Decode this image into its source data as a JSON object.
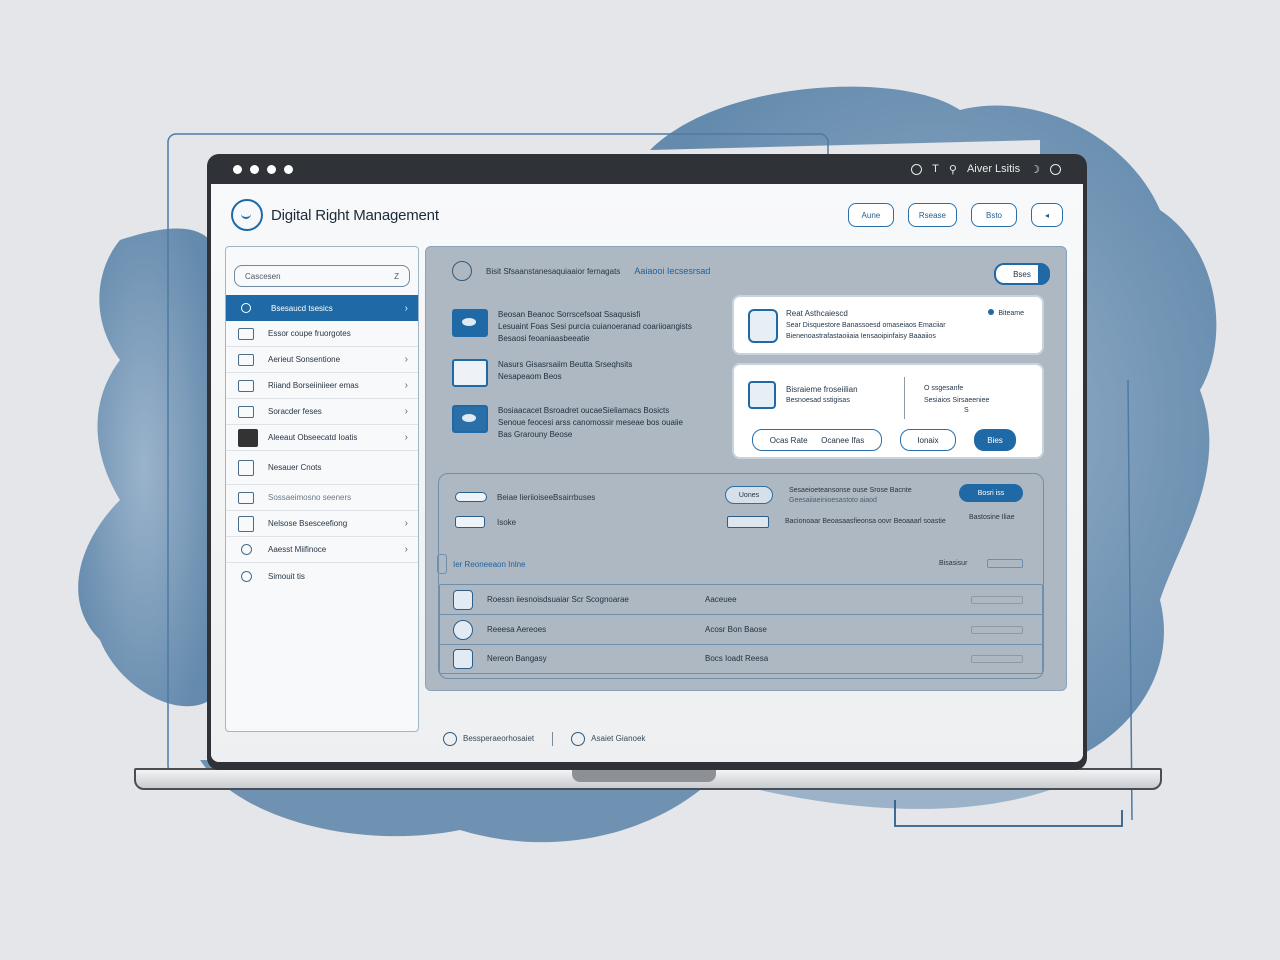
{
  "window": {
    "tray_text": "Aiver Lsitis"
  },
  "header": {
    "title": "Digital Right Management",
    "buttons": [
      "Aune",
      "Rsease",
      "Bsto",
      "◂"
    ]
  },
  "sidebar": {
    "search_placeholder": "Cascesen",
    "search_key": "Z",
    "items": [
      {
        "label": "Bsesaucd tsesics",
        "icon": "circle-icon",
        "active": true,
        "chevron": true
      },
      {
        "label": "Essor coupe fruorgotes",
        "icon": "image-icon",
        "active": false,
        "chevron": false
      },
      {
        "label": "Aerieut Sonsentione",
        "icon": "monitor-icon",
        "active": false,
        "chevron": true
      },
      {
        "label": "Riiand Borseiiniieer emas",
        "icon": "card-icon",
        "active": false,
        "chevron": true
      },
      {
        "label": "Soracder feses",
        "icon": "export-icon",
        "active": false,
        "chevron": true
      },
      {
        "label": "Aleeaut Obseecatd Ioatis",
        "icon": "document-dark-icon",
        "active": false,
        "chevron": true
      },
      {
        "label": "Nesauer Cnots",
        "icon": "file-icon",
        "active": false,
        "chevron": false
      },
      {
        "label": "Sossaeimosno seeners",
        "icon": "window-icon",
        "active": false,
        "chevron": false
      },
      {
        "label": "Nelsose Bsesceefiong",
        "icon": "frame-icon",
        "active": false,
        "chevron": true
      },
      {
        "label": "Aaesst Miifinoce",
        "icon": "ring-icon",
        "active": false,
        "chevron": true
      },
      {
        "label": "Simouit tis",
        "icon": "ring-icon",
        "active": false,
        "chevron": false
      }
    ]
  },
  "main": {
    "head_label": "Bisit Sfsaanstanesaquiaaior fernagats",
    "head_accent": "Aaiaooi Iecsesrsad",
    "toggle_label": "Bses",
    "features": [
      {
        "line1": "Beosan Beanoc Sorrscefsoat Ssaqusisfi",
        "line2": "Lesuaint Foas Sesi purcia cuianoeranad coariioangists",
        "line3": "Besaosi feoaniaasbeeatie"
      },
      {
        "line1": "Nasurs Gisasrsaiim Beutta Srseqhsits",
        "line2": "Nesapeaom Beos",
        "line3": ""
      },
      {
        "line1": "Bosiaacacet Bsroadret oucaeSieliamacs Bosicts",
        "line2": "Senoue feocesi arss canomossir meseae bos ouaiie",
        "line3": "Bas Grarouny Beose"
      }
    ],
    "card1": {
      "title": "Reat Asthcaiescd",
      "line1": "Sear Disquestore Banassoesd omaseiaos Emaciiar",
      "line2": "Bienenoastrafastaoiiaia Iensaoipinfaisy Baaaiios",
      "status": "Biteame"
    },
    "card2": {
      "title": "Bisraieme froseiilian",
      "subtitle": "Besnoesad sstigisas",
      "right1": "O ssgesanfe",
      "right2": "Sesiaios Sirsaeeniee",
      "right3": "S",
      "btn1": "Ocas Rate",
      "btn2": "Ocanee Ifas",
      "btn3": "Ionaix",
      "btn4": "Bies"
    },
    "sub": {
      "row1_label": "Beiae lieriioiseeBsairrbuses",
      "row1_btn": "Uones",
      "row1_right": "Sesaeioeteansonse ouse Srose Bacnte",
      "row1_right2": "Geesaiiaeinioesastoto aiaod",
      "row1_fill": "Bosri iss",
      "row2_label": "Isoke",
      "row2_right": "Bacionoaar Beoasaasfieonsa oovr Beoaaarl soastie",
      "row2_right2": "Bastosine Iliae",
      "list_title": "Ier Reoneeaon Inlne",
      "list_right": "Bisasisur",
      "rows": [
        {
          "c1": "Roessn iiesnoisdsuaiar Scr Scognoarae",
          "c2": "Aaceuee"
        },
        {
          "c1": "Reeesa Aereoes",
          "c2": "Acosr Bon Baose"
        },
        {
          "c1": "Nereon Bangasy",
          "c2": "Bocs Ioadt Reesa"
        }
      ]
    }
  },
  "footer": {
    "item1": "Bessperaeorhosaiet",
    "item2": "Asaiet Gianoek"
  },
  "colors": {
    "accent": "#1f6aa6",
    "panel": "#aeb8c2",
    "watercolor": "#5f86ab"
  }
}
